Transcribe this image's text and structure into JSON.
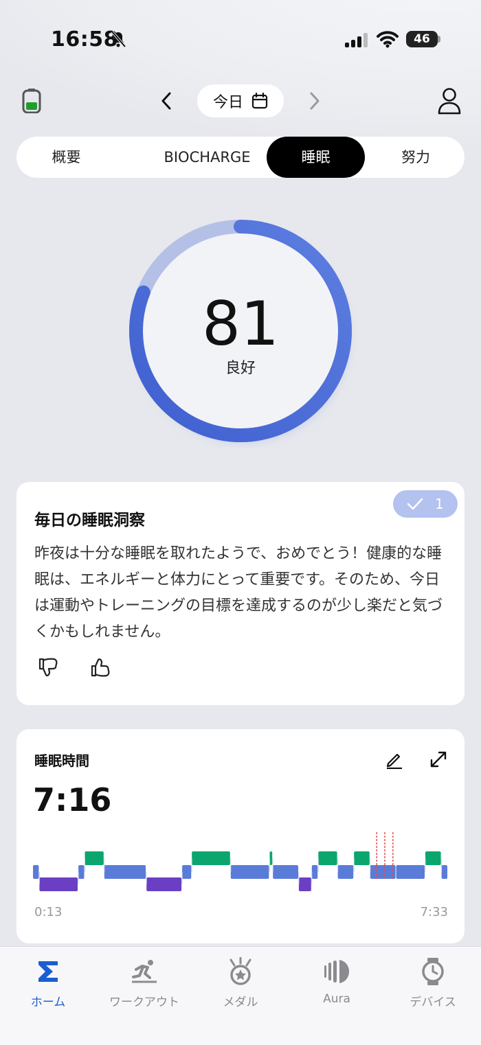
{
  "status_bar": {
    "time": "16:58",
    "battery": "46"
  },
  "header": {
    "date_label": "今日"
  },
  "tabs": [
    {
      "label": "概要",
      "active": false
    },
    {
      "label": "BIOCHARGE",
      "active": false
    },
    {
      "label": "睡眠",
      "active": true
    },
    {
      "label": "努力",
      "active": false
    }
  ],
  "score": {
    "value": "81",
    "label": "良好",
    "fraction": 0.81
  },
  "insight": {
    "title": "毎日の睡眠洞察",
    "badge_count": "1",
    "body": "昨夜は十分な睡眠を取れたようで、おめでとう！健康的な睡眠は、エネルギーと体力にとって重要です。そのため、今日は運動やトレーニングの目標を達成するのが少し楽だと気づくかもしれません。"
  },
  "sleep": {
    "title": "睡眠時間",
    "duration": "7:16",
    "start_time": "0:13",
    "end_time": "7:33",
    "colors": {
      "awake": "#0aa66e",
      "light": "#5a7bd8",
      "deep": "#6a3fc4",
      "marker": "#e0504f"
    },
    "stages": [
      [
        "light",
        0,
        2
      ],
      [
        "deep",
        2,
        14
      ],
      [
        "light",
        14,
        16
      ],
      [
        "awake",
        16,
        22
      ],
      [
        "light",
        22,
        35
      ],
      [
        "deep",
        35,
        46
      ],
      [
        "light",
        46,
        49
      ],
      [
        "awake",
        49,
        61
      ],
      [
        "light",
        61,
        73
      ],
      [
        "awake",
        73,
        74
      ],
      [
        "light",
        74,
        82
      ],
      [
        "deep",
        82,
        86
      ],
      [
        "light",
        86,
        88
      ],
      [
        "awake",
        88,
        94
      ],
      [
        "light",
        94,
        99
      ],
      [
        "awake",
        99,
        104
      ],
      [
        "light",
        104,
        112
      ],
      [
        "light",
        112,
        121
      ],
      [
        "awake",
        121,
        126
      ],
      [
        "light",
        126,
        128
      ]
    ],
    "markers": [
      106,
      108.5,
      111
    ]
  },
  "bottom_nav": [
    {
      "label": "ホーム",
      "icon": "sigma-icon",
      "active": true
    },
    {
      "label": "ワークアウト",
      "icon": "runner-icon",
      "active": false
    },
    {
      "label": "メダル",
      "icon": "medal-icon",
      "active": false
    },
    {
      "label": "Aura",
      "icon": "aura-icon",
      "active": false
    },
    {
      "label": "デバイス",
      "icon": "watch-icon",
      "active": false
    }
  ]
}
